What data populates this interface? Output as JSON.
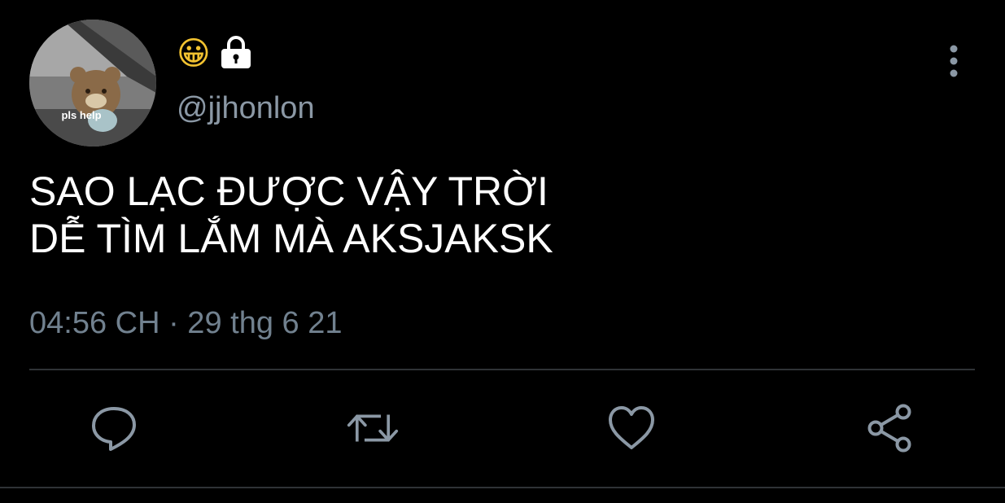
{
  "author": {
    "avatar_caption": "pls help",
    "name_emoji": "😀",
    "lock_icon": "lock-icon",
    "handle": "@jjhonlon"
  },
  "tweet": {
    "lines": [
      "SAO LẠC ĐƯỢC VẬY TRỜI",
      "DỄ TÌM LẮM MÀ AKSJAKSK"
    ],
    "timestamp": "04:56 CH · 29 thg 6 21"
  },
  "actions": [
    {
      "name": "reply",
      "icon": "comment-bubble-icon"
    },
    {
      "name": "retweet",
      "icon": "retweet-icon"
    },
    {
      "name": "like",
      "icon": "heart-icon"
    },
    {
      "name": "share",
      "icon": "share-icon"
    }
  ],
  "colors": {
    "background": "#000000",
    "text": "#ffffff",
    "secondary": "#8b98a5",
    "icon": "#8b98a5",
    "divider": "#2f3336"
  }
}
